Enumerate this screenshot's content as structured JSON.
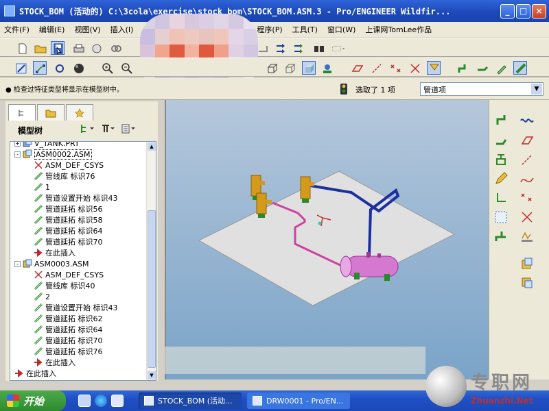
{
  "window": {
    "title": "STOCK_BOM (活动的) C:\\3cola\\exercise\\stock_bom\\STOCK_BOM.ASM.3 - Pro/ENGINEER Wildfir...",
    "min": "_",
    "max": "□",
    "close": "×"
  },
  "menu": [
    "文件(F)",
    "编辑(E)",
    "视图(V)",
    "插入(I)",
    "",
    "",
    "",
    "程序(P)",
    "工具(T)",
    "窗口(W)",
    "上课网TomLee作品"
  ],
  "status": {
    "hint": "● 检查过特征类型将显示在模型树中。",
    "selection": "选取了 1 项",
    "filter": "管道项"
  },
  "left_panel": {
    "title": "模型树",
    "tree": [
      {
        "label": "V_TANK.PRT",
        "indent": 1,
        "icon": "part-icon",
        "expander": "+"
      },
      {
        "label": "ASM0002.ASM",
        "indent": 1,
        "icon": "assembly-icon",
        "expander": "-",
        "highlight": true
      },
      {
        "label": "ASM_DEF_CSYS",
        "indent": 2,
        "icon": "csys-icon"
      },
      {
        "label": "管线库 标识76",
        "indent": 2,
        "icon": "pipe-library-icon"
      },
      {
        "label": "1",
        "indent": 2,
        "icon": "pipeline-icon"
      },
      {
        "label": "管道设置开始 标识43",
        "indent": 2,
        "icon": "pipe-start-icon"
      },
      {
        "label": "管道延拓 标识56",
        "indent": 2,
        "icon": "pipe-extend-icon"
      },
      {
        "label": "管道延拓 标识58",
        "indent": 2,
        "icon": "pipe-extend-icon"
      },
      {
        "label": "管道延拓 标识64",
        "indent": 2,
        "icon": "pipe-extend-icon"
      },
      {
        "label": "管道延拓 标识70",
        "indent": 2,
        "icon": "pipe-extend-icon"
      },
      {
        "label": "在此插入",
        "indent": 2,
        "icon": "insert-here-icon"
      },
      {
        "label": "ASM0003.ASM",
        "indent": 1,
        "icon": "assembly-icon",
        "expander": "-"
      },
      {
        "label": "ASM_DEF_CSYS",
        "indent": 2,
        "icon": "csys-icon"
      },
      {
        "label": "管线库 标识40",
        "indent": 2,
        "icon": "pipe-library-icon"
      },
      {
        "label": "2",
        "indent": 2,
        "icon": "pipeline-icon"
      },
      {
        "label": "管道设置开始 标识43",
        "indent": 2,
        "icon": "pipe-start-icon"
      },
      {
        "label": "管道延拓 标识62",
        "indent": 2,
        "icon": "pipe-extend-icon"
      },
      {
        "label": "管道延拓 标识64",
        "indent": 2,
        "icon": "pipe-extend-icon"
      },
      {
        "label": "管道延拓 标识70",
        "indent": 2,
        "icon": "pipe-extend-icon"
      },
      {
        "label": "管道延拓 标识76",
        "indent": 2,
        "icon": "pipe-extend-icon"
      },
      {
        "label": "在此插入",
        "indent": 2,
        "icon": "insert-here-icon"
      },
      {
        "label": "在此插入",
        "indent": 1,
        "icon": "insert-here-icon"
      }
    ]
  },
  "taskbar": {
    "start": "开始",
    "items": [
      "STOCK_BOM (活动...",
      "DRW0001 - Pro/EN..."
    ]
  },
  "watermark": {
    "name": "专职网",
    "url": "Zhuanzhi.Net"
  },
  "colors": {
    "pipe_blue": "#1b2fa0",
    "pipe_magenta": "#d040a0",
    "tank": "#d478d0",
    "fitting": "#d39a1c",
    "plate": "#e0e0e0"
  }
}
